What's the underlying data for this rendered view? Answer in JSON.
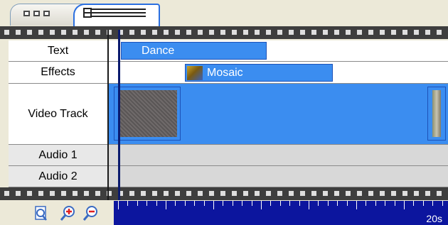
{
  "rows": [
    {
      "label": "Text"
    },
    {
      "label": "Effects"
    },
    {
      "label": "Video Track"
    },
    {
      "label": "Audio 1"
    },
    {
      "label": "Audio 2"
    }
  ],
  "clips": {
    "text": "Dance",
    "effect": "Mosaic"
  },
  "ruler": {
    "time_label": "20s"
  },
  "icons": {
    "storyboard_view": "storyboard-icon",
    "timeline_view": "timeline-icon",
    "zoom_to_fit": "page-zoom-icon",
    "zoom_in": "zoom-in-icon",
    "zoom_out": "zoom-out-icon"
  },
  "colors": {
    "clip_blue": "#3b8df0",
    "ruler_blue": "#0c159e",
    "filmstrip": "#3e3e3e"
  }
}
